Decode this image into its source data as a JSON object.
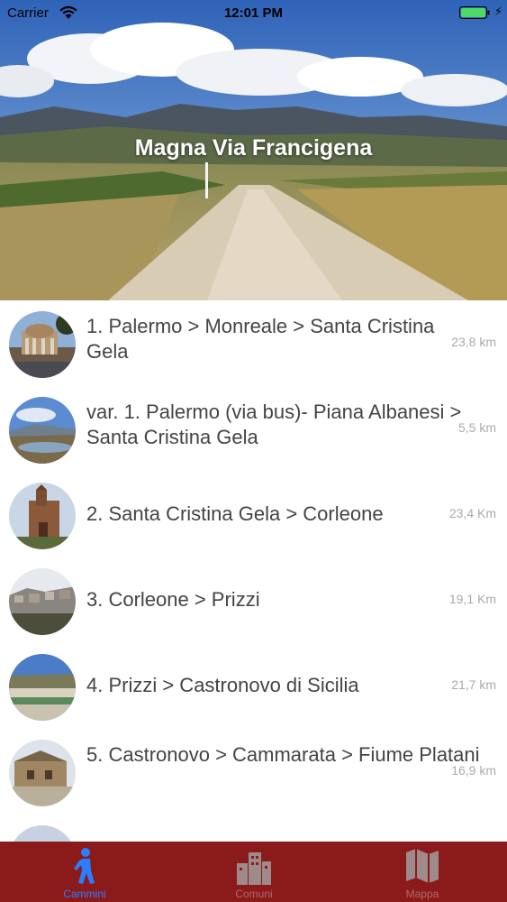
{
  "status_bar": {
    "carrier": "Carrier",
    "time": "12:01 PM"
  },
  "header": {
    "title": "Magna Via Francigena"
  },
  "routes": [
    {
      "title": "1. Palermo > Monreale > Santa Cristina Gela",
      "distance": "23,8 km",
      "thumb": "palermo-theatre"
    },
    {
      "title": "var. 1. Palermo (via bus)- Piana Albanesi > Santa Cristina Gela",
      "distance": "5,5 km",
      "thumb": "lake-panorama"
    },
    {
      "title": "2. Santa Cristina Gela > Corleone",
      "distance": "23,4 Km",
      "thumb": "church"
    },
    {
      "title": "3. Corleone > Prizzi",
      "distance": "19,1 Km",
      "thumb": "hill-town"
    },
    {
      "title": "4. Prizzi > Castronovo di Sicilia",
      "distance": "21,7 km",
      "thumb": "river"
    },
    {
      "title": "5. Castronovo > Cammarata > Fiume Platani",
      "distance": "16,9 km",
      "thumb": "farmhouse"
    }
  ],
  "tabs": [
    {
      "label": "Cammini",
      "icon": "walking-person-icon",
      "active": true
    },
    {
      "label": "Comuni",
      "icon": "buildings-icon",
      "active": false
    },
    {
      "label": "Mappa",
      "icon": "map-icon",
      "active": false
    }
  ],
  "colors": {
    "tabbar": "#8b1a1a",
    "active_tab": "#2a7fff",
    "inactive_tab": "#b06a6a",
    "route_text": "#444444",
    "distance_text": "#aaaaaa"
  }
}
